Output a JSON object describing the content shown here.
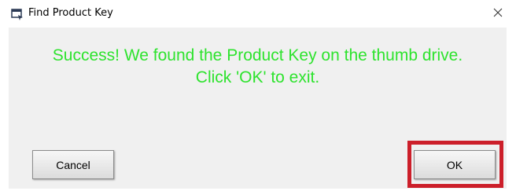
{
  "window": {
    "title": "Find Product Key",
    "icon": "app-window-icon",
    "close_icon": "close-icon"
  },
  "message": {
    "line1": "Success! We found the Product Key on the thumb drive.",
    "line2": "Click 'OK' to exit.",
    "color": "#2ee32e"
  },
  "buttons": {
    "cancel_label": "Cancel",
    "ok_label": "OK"
  },
  "highlight": {
    "target": "ok-button",
    "color": "#cc1f2a"
  }
}
